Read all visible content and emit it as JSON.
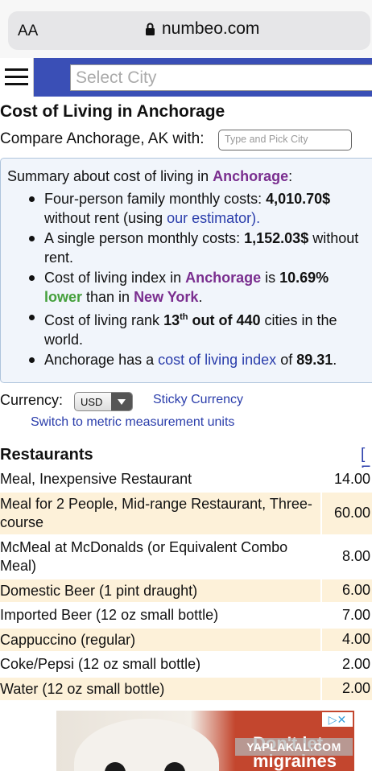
{
  "browser": {
    "aa_label": "AA",
    "url": "numbeo.com"
  },
  "nav": {
    "city_placeholder": "Select City"
  },
  "page": {
    "title": "Cost of Living in Anchorage",
    "compare_label": "Compare Anchorage, AK with:",
    "compare_placeholder": "Type and Pick City"
  },
  "summary": {
    "heading_prefix": "Summary about cost of living in ",
    "city": "Anchorage",
    "heading_suffix": ":",
    "family_prefix": "Four-person family monthly costs: ",
    "family_value": "4,010.70$",
    "family_line2_prefix": "without rent (using ",
    "estimator_link": "our estimator",
    "family_line2_suffix": ").",
    "single_prefix": "A single person monthly costs: ",
    "single_value": "1,152.03$",
    "single_suffix": " without",
    "single_line2": "rent.",
    "index_prefix": "Cost of living index in ",
    "index_city": "Anchorage",
    "index_mid": " is ",
    "index_value": "10.69%",
    "index_lower": "lower",
    "index_than": " than in ",
    "index_compare_city": "New York",
    "index_end": ".",
    "rank_prefix": "Cost of living rank ",
    "rank_value": "13",
    "rank_sup": "th",
    "rank_out_of": " out of 440",
    "rank_suffix": " cities in the",
    "rank_line2": "world.",
    "has_prefix": "Anchorage has a ",
    "has_link": "cost of living index",
    "has_mid": " of ",
    "has_value": "89.31",
    "has_end": "."
  },
  "currency": {
    "label": "Currency:",
    "selected": "USD",
    "sticky_link": "Sticky Currency",
    "metric_link": "Switch to metric measurement units"
  },
  "restaurants": {
    "title": "Restaurants",
    "bracket": "[ E",
    "rows": [
      {
        "item": "Meal, Inexpensive Restaurant",
        "value": "14.00"
      },
      {
        "item": "Meal for 2 People, Mid-range Restaurant, Three-course",
        "value": "60.00"
      },
      {
        "item": "McMeal at McDonalds (or Equivalent Combo Meal)",
        "value": "8.00"
      },
      {
        "item": "Domestic Beer (1 pint draught)",
        "value": "6.00"
      },
      {
        "item": "Imported Beer (12 oz small bottle)",
        "value": "7.00"
      },
      {
        "item": "Cappuccino (regular)",
        "value": "4.00"
      },
      {
        "item": "Coke/Pepsi (12 oz small bottle)",
        "value": "2.00"
      },
      {
        "item": "Water (12 oz small bottle)",
        "value": "2.00"
      }
    ]
  },
  "ad": {
    "headline": "Don't let migraines",
    "close": "▷✕",
    "watermark": "YAPLAKAL.COM"
  }
}
